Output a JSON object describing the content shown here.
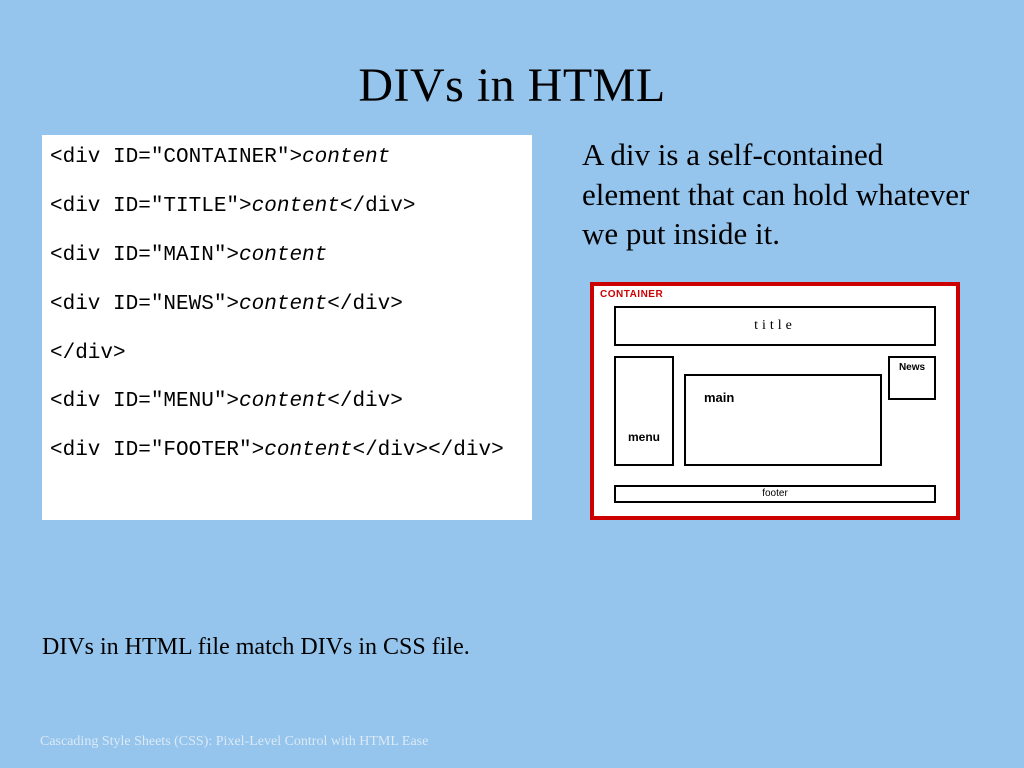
{
  "title": "DIVs in HTML",
  "code": {
    "l1a": "<div ID=\"CONTAINER\">",
    "l1b": "content",
    "l2a": "<div ID=\"TITLE\">",
    "l2b": "content",
    "l2c": "</div>",
    "l3a": "<div ID=\"MAIN\">",
    "l3b": "content",
    "l4a": "<div ID=\"NEWS\">",
    "l4b": "content",
    "l4c": "</div>",
    "l5": "</div>",
    "l6a": "<div ID=\"MENU\">",
    "l6b": "content",
    "l6c": "</div>",
    "l7a": "<div ID=\"FOOTER\">",
    "l7b": "content",
    "l7c": "</div></div>"
  },
  "description": "A div is a self-contained element that can hold whatever we put inside it.",
  "diagram": {
    "container": "CONTAINER",
    "title": "title",
    "menu": "menu",
    "news": "News",
    "main": "main",
    "footer": "footer"
  },
  "caption": "DIVs in HTML file match DIVs in CSS file.",
  "footer": "Cascading Style Sheets (CSS): Pixel-Level Control with HTML Ease"
}
